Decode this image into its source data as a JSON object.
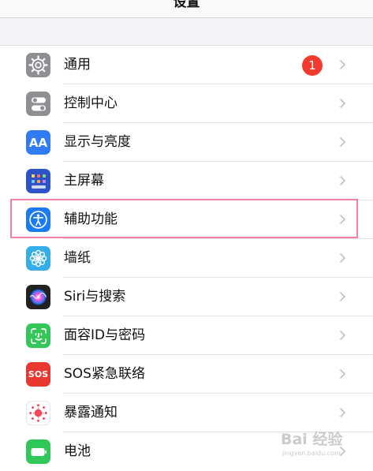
{
  "nav": {
    "title": "设置"
  },
  "colors": {
    "general": "#8e8e93",
    "control_center": "#8e8e93",
    "display": "#2f7cf6",
    "home_screen": "#2c53c8",
    "accessibility": "#1a7bf2",
    "wallpaper": "#33aee8",
    "siri": "#222222",
    "face_id": "#32c759",
    "sos": "#e8382f",
    "exposure": "#ffffff",
    "battery": "#32c759",
    "badge": "#f23a2f",
    "highlight_border": "#f27fa6"
  },
  "settings": {
    "items": [
      {
        "label": "通用",
        "icon": "gear-icon",
        "badge": "1"
      },
      {
        "label": "控制中心",
        "icon": "toggles-icon"
      },
      {
        "label": "显示与亮度",
        "icon": "text-size-icon",
        "icon_text": "AA"
      },
      {
        "label": "主屏幕",
        "icon": "app-grid-icon"
      },
      {
        "label": "辅助功能",
        "icon": "accessibility-icon"
      },
      {
        "label": "墙纸",
        "icon": "flower-icon"
      },
      {
        "label": "Siri与搜索",
        "icon": "siri-icon"
      },
      {
        "label": "面容ID与密码",
        "icon": "face-id-icon"
      },
      {
        "label": "SOS紧急联络",
        "icon": "sos-icon",
        "icon_text": "SOS"
      },
      {
        "label": "暴露通知",
        "icon": "exposure-icon"
      },
      {
        "label": "电池",
        "icon": "battery-icon"
      }
    ]
  },
  "watermark": {
    "main": "Bai 经验",
    "sub": "jingyan.baidu.com"
  }
}
